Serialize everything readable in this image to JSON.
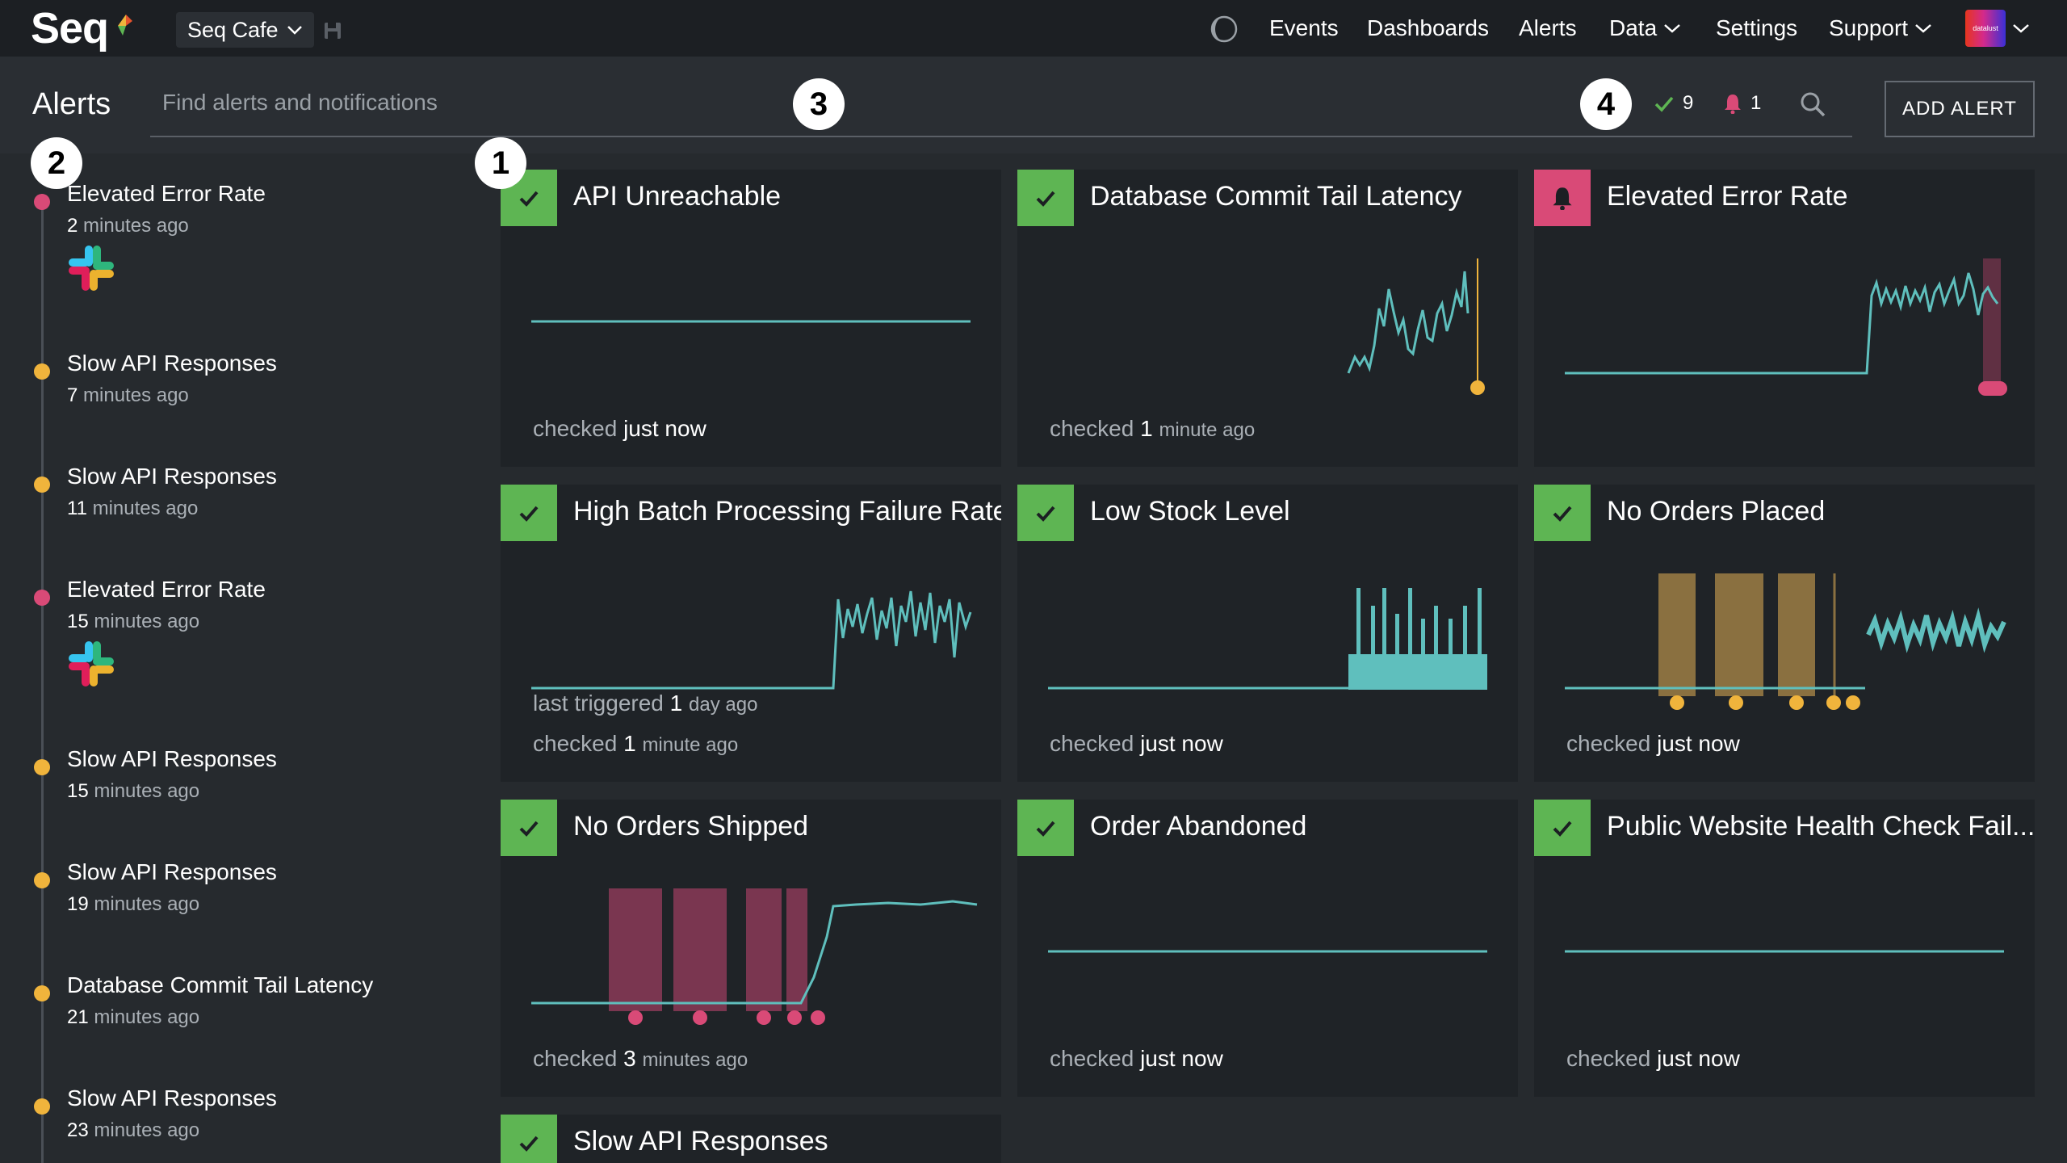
{
  "app": {
    "logo_text": "Seq",
    "workspace": "Seq Cafe"
  },
  "nav": {
    "events": "Events",
    "dashboards": "Dashboards",
    "alerts": "Alerts",
    "data": "Data",
    "settings": "Settings",
    "support": "Support",
    "avatar_text": "datalust"
  },
  "header": {
    "title": "Alerts",
    "search_placeholder": "Find alerts and notifications",
    "ok_count": "9",
    "alarm_count": "1",
    "add_button": "ADD ALERT"
  },
  "badges": [
    "1",
    "2",
    "3",
    "4"
  ],
  "colors": {
    "ok": "#5eb553",
    "alarm": "#d94a77",
    "warning": "#f0b43c",
    "series": "#5fbfbd"
  },
  "notifications": [
    {
      "title": "Elevated Error Rate",
      "time_num": "2",
      "time_unit": "minutes ago",
      "level": "alarm",
      "slack": true
    },
    {
      "title": "Slow API Responses",
      "time_num": "7",
      "time_unit": "minutes ago",
      "level": "warning",
      "slack": false
    },
    {
      "title": "Slow API Responses",
      "time_num": "11",
      "time_unit": "minutes ago",
      "level": "warning",
      "slack": false
    },
    {
      "title": "Elevated Error Rate",
      "time_num": "15",
      "time_unit": "minutes ago",
      "level": "alarm",
      "slack": true
    },
    {
      "title": "Slow API Responses",
      "time_num": "15",
      "time_unit": "minutes ago",
      "level": "warning",
      "slack": false
    },
    {
      "title": "Slow API Responses",
      "time_num": "19",
      "time_unit": "minutes ago",
      "level": "warning",
      "slack": false
    },
    {
      "title": "Database Commit Tail Latency",
      "time_num": "21",
      "time_unit": "minutes ago",
      "level": "warning",
      "slack": false
    },
    {
      "title": "Slow API Responses",
      "time_num": "23",
      "time_unit": "minutes ago",
      "level": "warning",
      "slack": false
    }
  ],
  "alerts": [
    {
      "title": "API Unreachable",
      "status": "ok",
      "checked_label": "checked",
      "checked_value": "just now",
      "checked_unit": ""
    },
    {
      "title": "Database Commit Tail Latency",
      "status": "ok",
      "checked_label": "checked",
      "checked_value": "1",
      "checked_unit": "minute ago"
    },
    {
      "title": "Elevated Error Rate",
      "status": "alarm",
      "checked_label": "",
      "checked_value": "",
      "checked_unit": ""
    },
    {
      "title": "High Batch Processing Failure Rate",
      "status": "ok",
      "triggered_label": "last triggered",
      "triggered_value": "1",
      "triggered_unit": "day ago",
      "checked_label": "checked",
      "checked_value": "1",
      "checked_unit": "minute ago"
    },
    {
      "title": "Low Stock Level",
      "status": "ok",
      "checked_label": "checked",
      "checked_value": "just now",
      "checked_unit": ""
    },
    {
      "title": "No Orders Placed",
      "status": "ok",
      "checked_label": "checked",
      "checked_value": "just now",
      "checked_unit": ""
    },
    {
      "title": "No Orders Shipped",
      "status": "ok",
      "checked_label": "checked",
      "checked_value": "3",
      "checked_unit": "minutes ago"
    },
    {
      "title": "Order Abandoned",
      "status": "ok",
      "checked_label": "checked",
      "checked_value": "just now",
      "checked_unit": ""
    },
    {
      "title": "Public Website Health Check Fail...",
      "status": "ok",
      "checked_label": "checked",
      "checked_value": "just now",
      "checked_unit": ""
    },
    {
      "title": "Slow API Responses",
      "status": "ok",
      "checked_label": "",
      "checked_value": "",
      "checked_unit": ""
    }
  ]
}
